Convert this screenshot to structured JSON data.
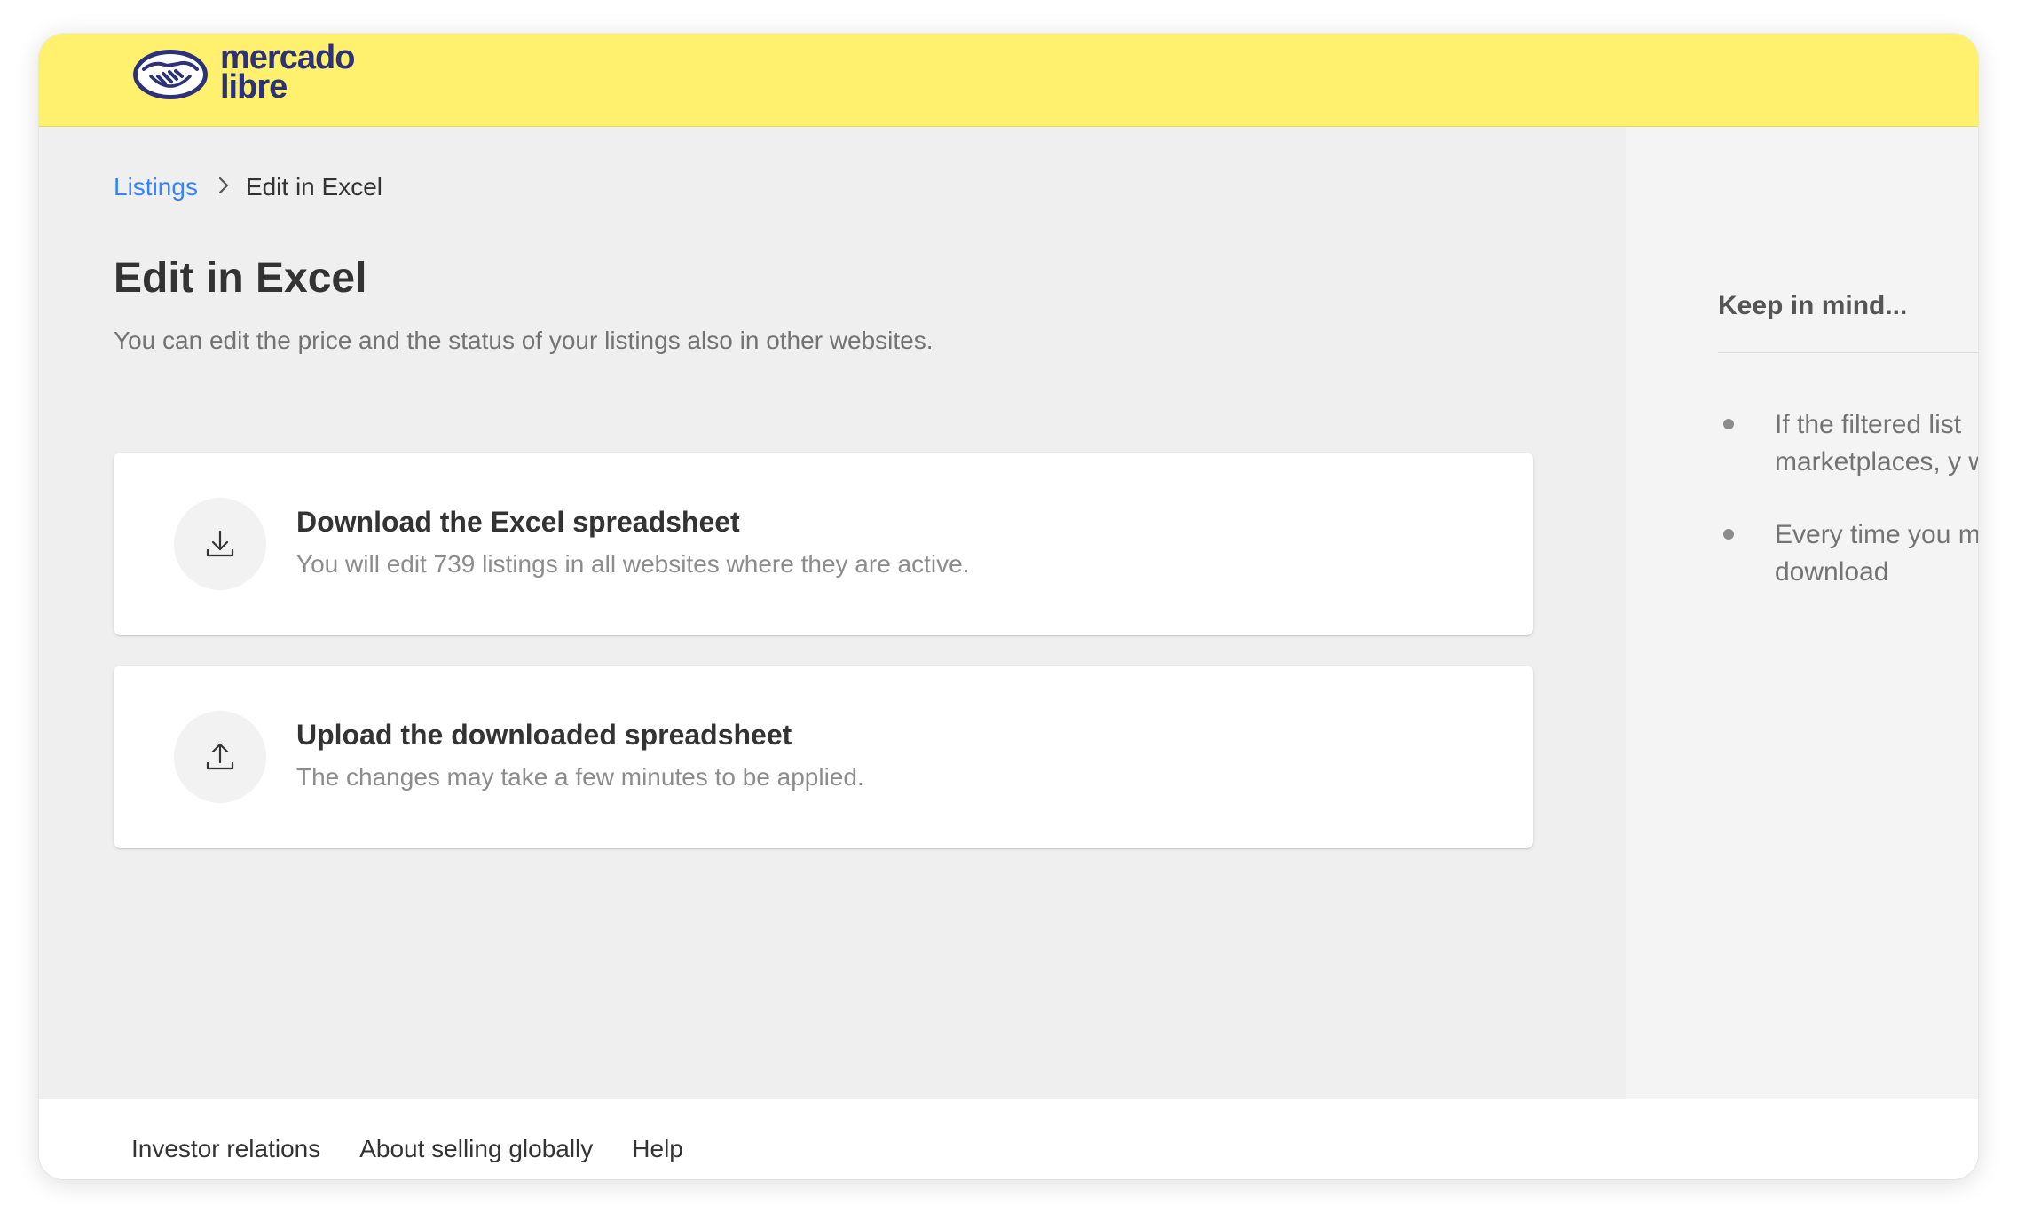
{
  "brand": {
    "name_line1": "mercado",
    "name_line2": "libre",
    "header_color": "#fff16e",
    "text_color": "#2d3277"
  },
  "breadcrumb": {
    "parent": "Listings",
    "separator": ">",
    "current": "Edit in Excel"
  },
  "page": {
    "title": "Edit in Excel",
    "subtitle": "You can edit the price and the status of your listings also in other websites."
  },
  "cards": {
    "download": {
      "icon": "download-icon",
      "title": "Download the Excel spreadsheet",
      "description": "You will edit 739 listings in all websites where they are active."
    },
    "upload": {
      "icon": "upload-icon",
      "title": "Upload the downloaded spreadsheet",
      "description": "The changes may take a few minutes to be applied."
    }
  },
  "aside": {
    "title": "Keep in mind...",
    "items": [
      "If the filtered list marketplaces, y well.",
      "Every time you must download"
    ]
  },
  "footer": {
    "links": [
      "Investor relations",
      "About selling globally",
      "Help"
    ]
  },
  "colors": {
    "link": "#3483fa",
    "background": "#efefef"
  }
}
